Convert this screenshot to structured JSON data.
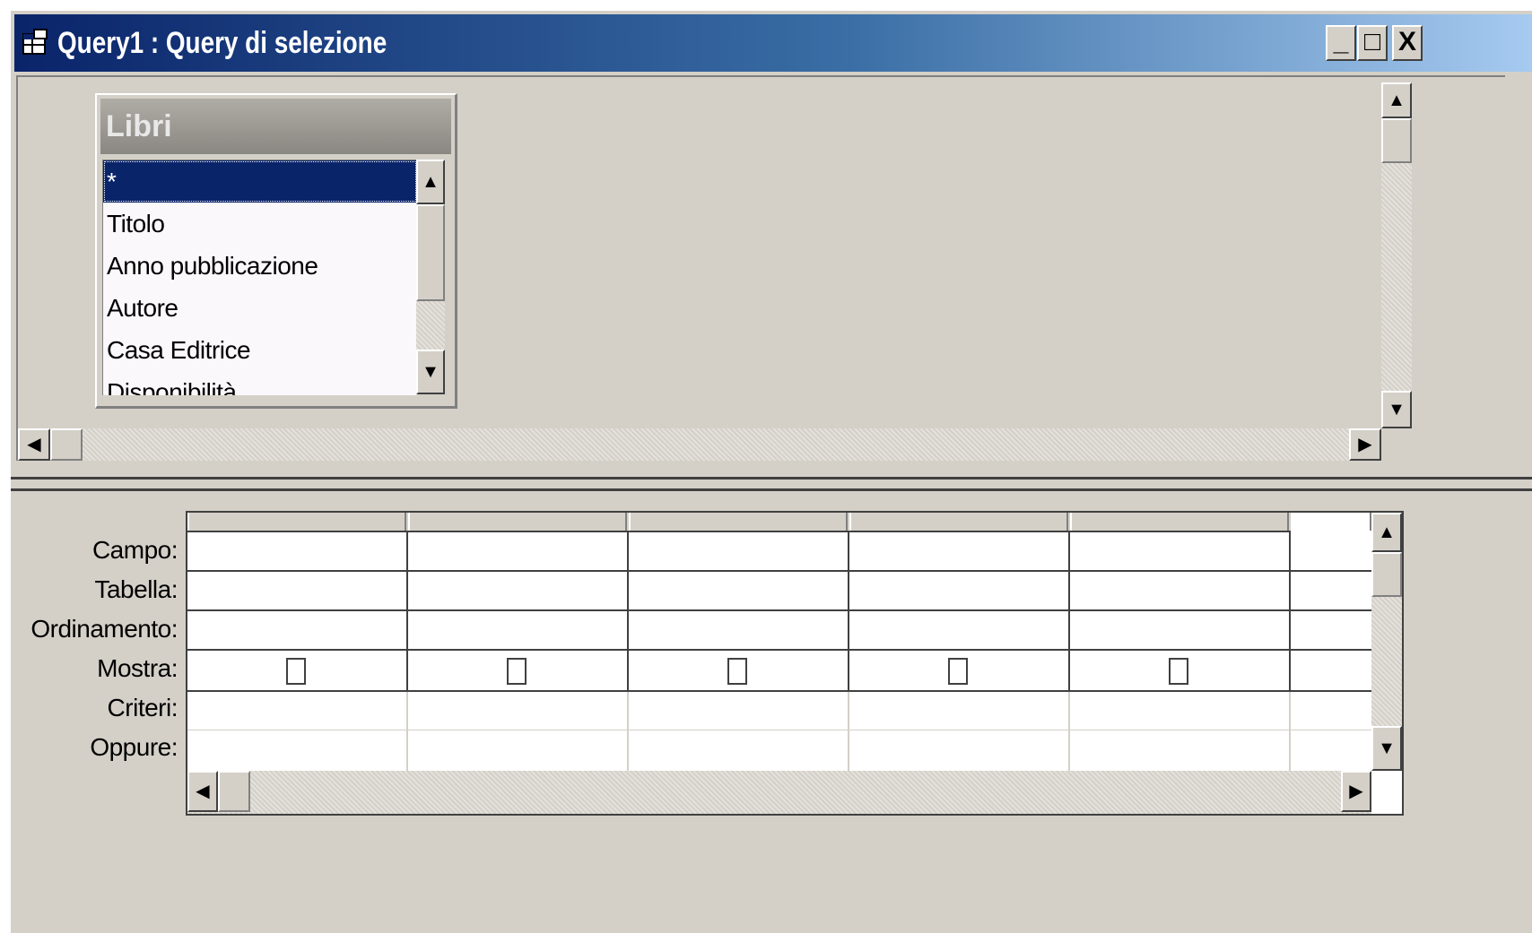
{
  "window": {
    "title": "Query1 : Query di selezione",
    "minimize_label": "_",
    "maximize_label": "□",
    "close_label": "X"
  },
  "field_list": {
    "table_name": "Libri",
    "fields": [
      "*",
      "Titolo",
      "Anno pubblicazione",
      "Autore",
      "Casa Editrice",
      "Disponibilità"
    ],
    "selected_index": 0
  },
  "query_grid": {
    "row_labels": [
      "Campo:",
      "Tabella:",
      "Ordinamento:",
      "Mostra:",
      "Criteri:",
      "Oppure:"
    ],
    "column_count": 5
  },
  "icons": {
    "scroll_up": "arrow-up-icon",
    "scroll_down": "arrow-down-icon",
    "scroll_left": "arrow-left-icon",
    "scroll_right": "arrow-right-icon",
    "window": "query-window-icon"
  },
  "colors": {
    "title_start": "#0a246a",
    "title_end": "#a6caf0",
    "face": "#d4d0c8",
    "selection": "#0a246a"
  }
}
